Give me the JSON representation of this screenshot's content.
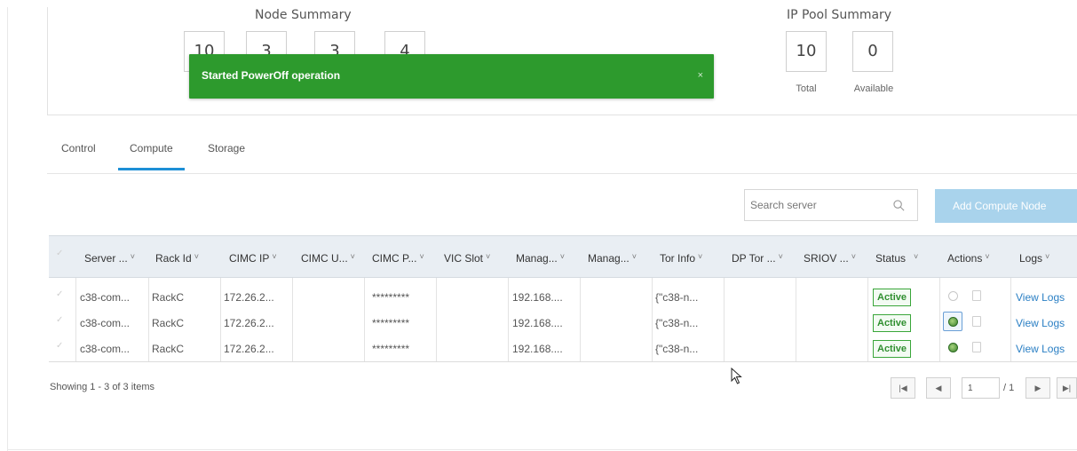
{
  "node_summary": {
    "title": "Node Summary",
    "counts": [
      "10",
      "3",
      "3",
      "4"
    ]
  },
  "ip_pool_summary": {
    "title": "IP Pool Summary",
    "total": {
      "value": "10",
      "label": "Total"
    },
    "available": {
      "value": "0",
      "label": "Available"
    }
  },
  "toast": {
    "message": "Started PowerOff operation",
    "close_glyph": "×",
    "color": "#2d9a2d"
  },
  "tabs": [
    {
      "label": "Control",
      "active": false
    },
    {
      "label": "Compute",
      "active": true
    },
    {
      "label": "Storage",
      "active": false
    }
  ],
  "toolbar": {
    "search_placeholder": "Search server",
    "add_button": "Add Compute Node"
  },
  "table": {
    "columns": [
      "Server ...",
      "Rack Id",
      "CIMC IP",
      "CIMC U...",
      "CIMC P...",
      "VIC Slot",
      "Manag...",
      "Manag...",
      "Tor Info",
      "DP Tor ...",
      "SRIOV ...",
      "Status",
      "Actions",
      "Logs"
    ],
    "rows": [
      {
        "server": "c38-com...",
        "rack": "RackC",
        "cimc_ip": "172.26.2...",
        "cimc_user": "",
        "cimc_pass": "*********",
        "vic_slot": "",
        "mgmt1": "192.168....",
        "mgmt2": "",
        "tor_info": "{\"c38-n...",
        "dp_tor": "",
        "sriov": "",
        "status": "Active",
        "power": "off",
        "logs": "View Logs"
      },
      {
        "server": "c38-com...",
        "rack": "RackC",
        "cimc_ip": "172.26.2...",
        "cimc_user": "",
        "cimc_pass": "*********",
        "vic_slot": "",
        "mgmt1": "192.168....",
        "mgmt2": "",
        "tor_info": "{\"c38-n...",
        "dp_tor": "",
        "sriov": "",
        "status": "Active",
        "power": "on",
        "logs": "View Logs"
      },
      {
        "server": "c38-com...",
        "rack": "RackC",
        "cimc_ip": "172.26.2...",
        "cimc_user": "",
        "cimc_pass": "*********",
        "vic_slot": "",
        "mgmt1": "192.168....",
        "mgmt2": "",
        "tor_info": "{\"c38-n...",
        "dp_tor": "",
        "sriov": "",
        "status": "Active",
        "power": "on",
        "logs": "View Logs"
      }
    ]
  },
  "footer": {
    "showing": "Showing 1 - 3 of 3 items",
    "page_value": "1",
    "page_total": "/ 1"
  },
  "colors": {
    "accent": "#1d8fd6",
    "add_button": "#a9d3ec",
    "status_green": "#3aa63a",
    "link": "#2a7fc4"
  }
}
